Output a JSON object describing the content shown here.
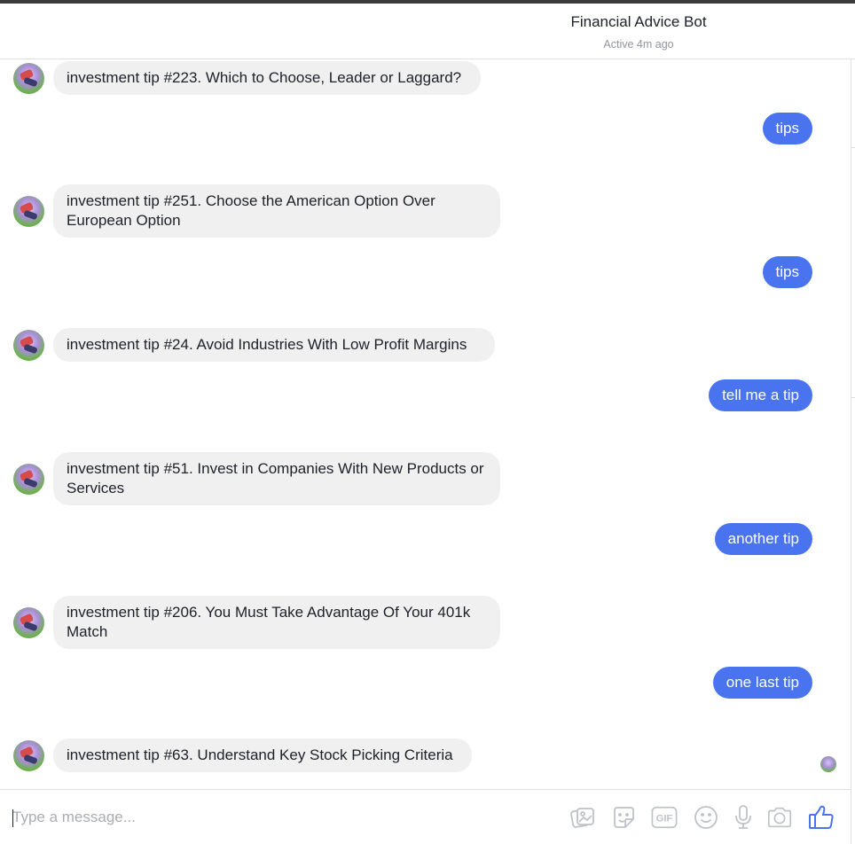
{
  "header": {
    "title": "Financial Advice Bot",
    "status": "Active 4m ago"
  },
  "messages": [
    {
      "from": "bot",
      "text": "investment tip #223. Which to Choose, Leader or Laggard?"
    },
    {
      "from": "user",
      "text": "tips"
    },
    {
      "from": "bot",
      "text": "investment tip #251. Choose the American Option Over European Option"
    },
    {
      "from": "user",
      "text": "tips"
    },
    {
      "from": "bot",
      "text": "investment tip #24. Avoid Industries With Low Profit Margins"
    },
    {
      "from": "user",
      "text": "tell me a tip"
    },
    {
      "from": "bot",
      "text": "investment tip #51. Invest in Companies With New Products or Services"
    },
    {
      "from": "user",
      "text": "another tip"
    },
    {
      "from": "bot",
      "text": "investment tip #206. You Must Take Advantage Of Your 401k Match"
    },
    {
      "from": "user",
      "text": "one last tip"
    },
    {
      "from": "bot",
      "text": "investment tip #63. Understand Key Stock Picking Criteria"
    }
  ],
  "composer": {
    "placeholder": "Type a message...",
    "value": "",
    "tools": [
      "image-icon",
      "sticker-icon",
      "gif-icon",
      "emoji-icon",
      "microphone-icon",
      "camera-icon",
      "like-icon"
    ],
    "gif_label": "GIF"
  },
  "colors": {
    "outgoing_bubble": "#4a73f0",
    "incoming_bubble": "#f1f0f0",
    "like_icon": "#4a73f0"
  }
}
